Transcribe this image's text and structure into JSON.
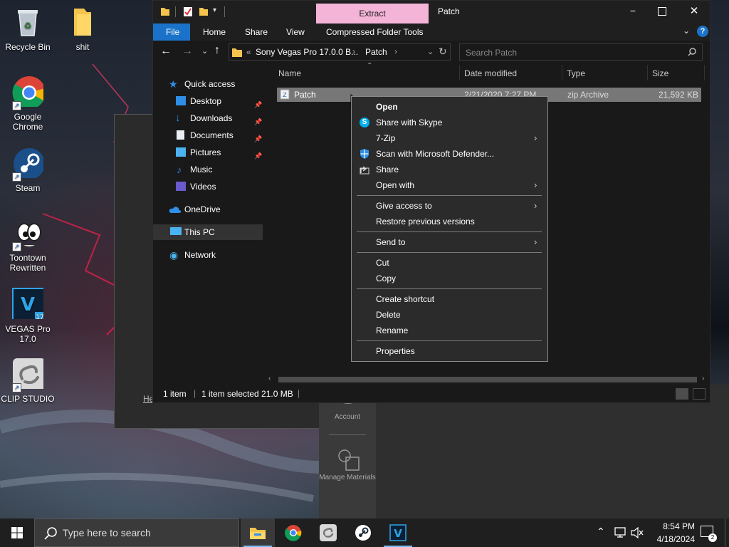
{
  "desktop": {
    "icons": [
      {
        "label": "Recycle Bin"
      },
      {
        "label": "shit"
      },
      {
        "label": "Google Chrome"
      },
      {
        "label": "Steam"
      },
      {
        "label": "Toontown Rewritten"
      },
      {
        "label": "VEGAS Pro 17.0"
      },
      {
        "label": "CLIP STUDIO"
      }
    ]
  },
  "background_app": {
    "account_label": "Account",
    "manage_materials_label": "Manage Materials",
    "help_fragment": "He"
  },
  "explorer": {
    "title": "Patch",
    "extract_tab": "Extract",
    "ribbon_tabs": [
      "File",
      "Home",
      "Share",
      "View",
      "Compressed Folder Tools"
    ],
    "breadcrumb_overflow": "«",
    "breadcrumb": [
      "Sony Vegas Pro 17.0.0 B...",
      "Patch"
    ],
    "search_placeholder": "Search Patch",
    "nav": {
      "quick_access": "Quick access",
      "desktop": "Desktop",
      "downloads": "Downloads",
      "documents": "Documents",
      "pictures": "Pictures",
      "music": "Music",
      "videos": "Videos",
      "onedrive": "OneDrive",
      "this_pc": "This PC",
      "network": "Network"
    },
    "columns": {
      "name": "Name",
      "date": "Date modified",
      "type": "Type",
      "size": "Size"
    },
    "files": [
      {
        "name": "Patch",
        "date": "2/21/2020 7:27 PM",
        "type": "zip Archive",
        "size": "21,592 KB"
      }
    ],
    "status": {
      "items": "1 item",
      "selected": "1 item selected  21.0 MB"
    }
  },
  "context_menu": {
    "open": "Open",
    "share_skype": "Share with Skype",
    "seven_zip": "7-Zip",
    "scan_defender": "Scan with Microsoft Defender...",
    "share": "Share",
    "open_with": "Open with",
    "give_access": "Give access to",
    "restore": "Restore previous versions",
    "send_to": "Send to",
    "cut": "Cut",
    "copy": "Copy",
    "create_shortcut": "Create shortcut",
    "delete": "Delete",
    "rename": "Rename",
    "properties": "Properties"
  },
  "taskbar": {
    "search_placeholder": "Type here to search",
    "time": "8:54 PM",
    "date": "4/18/2024"
  },
  "colors": {
    "extract_tab": "#f4b4d8",
    "file_tab": "#1a73c8",
    "selection": "#777777",
    "accent": "#0078d7"
  }
}
